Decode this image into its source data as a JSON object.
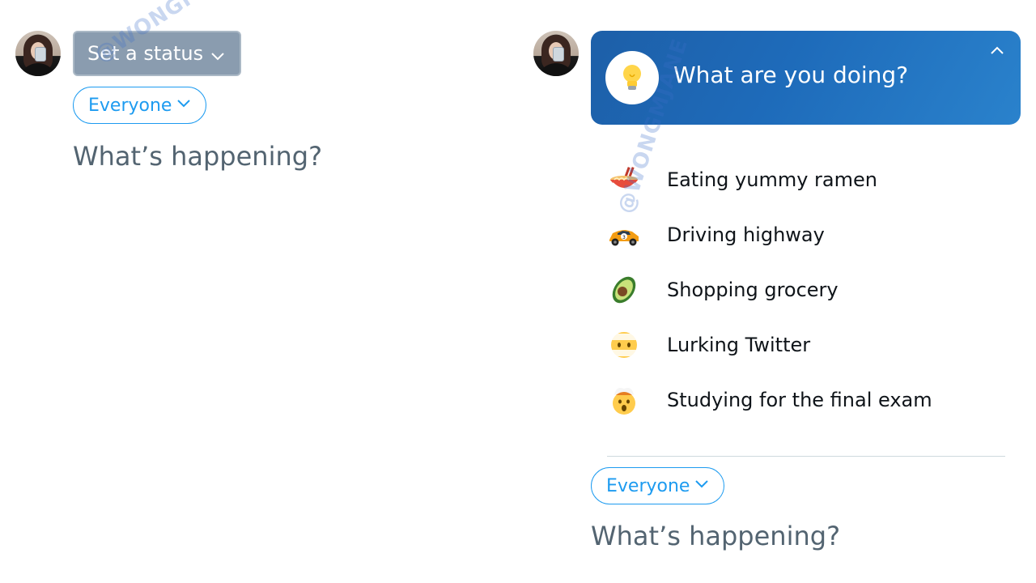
{
  "left_panel": {
    "status_button_label": "Set a status",
    "audience_label": "Everyone",
    "composer_placeholder": "What’s happening?"
  },
  "right_panel": {
    "header_title": "What are you doing?",
    "header_icon": "lightbulb-icon",
    "status_options": [
      {
        "emoji": "ramen-icon",
        "label": "Eating yummy ramen"
      },
      {
        "emoji": "race-car-icon",
        "label": "Driving highway"
      },
      {
        "emoji": "avocado-icon",
        "label": "Shopping grocery"
      },
      {
        "emoji": "fog-face-icon",
        "label": "Lurking Twitter"
      },
      {
        "emoji": "exploding-head-icon",
        "label": "Studying for the final exam"
      }
    ],
    "audience_label": "Everyone",
    "composer_placeholder": "What’s happening?"
  },
  "watermark_text": "@WONGMJANE",
  "colors": {
    "accent": "#1d9bf0",
    "status_button_bg": "#8a9caf",
    "header_bg": "#1e6bba",
    "placeholder": "#536471"
  }
}
